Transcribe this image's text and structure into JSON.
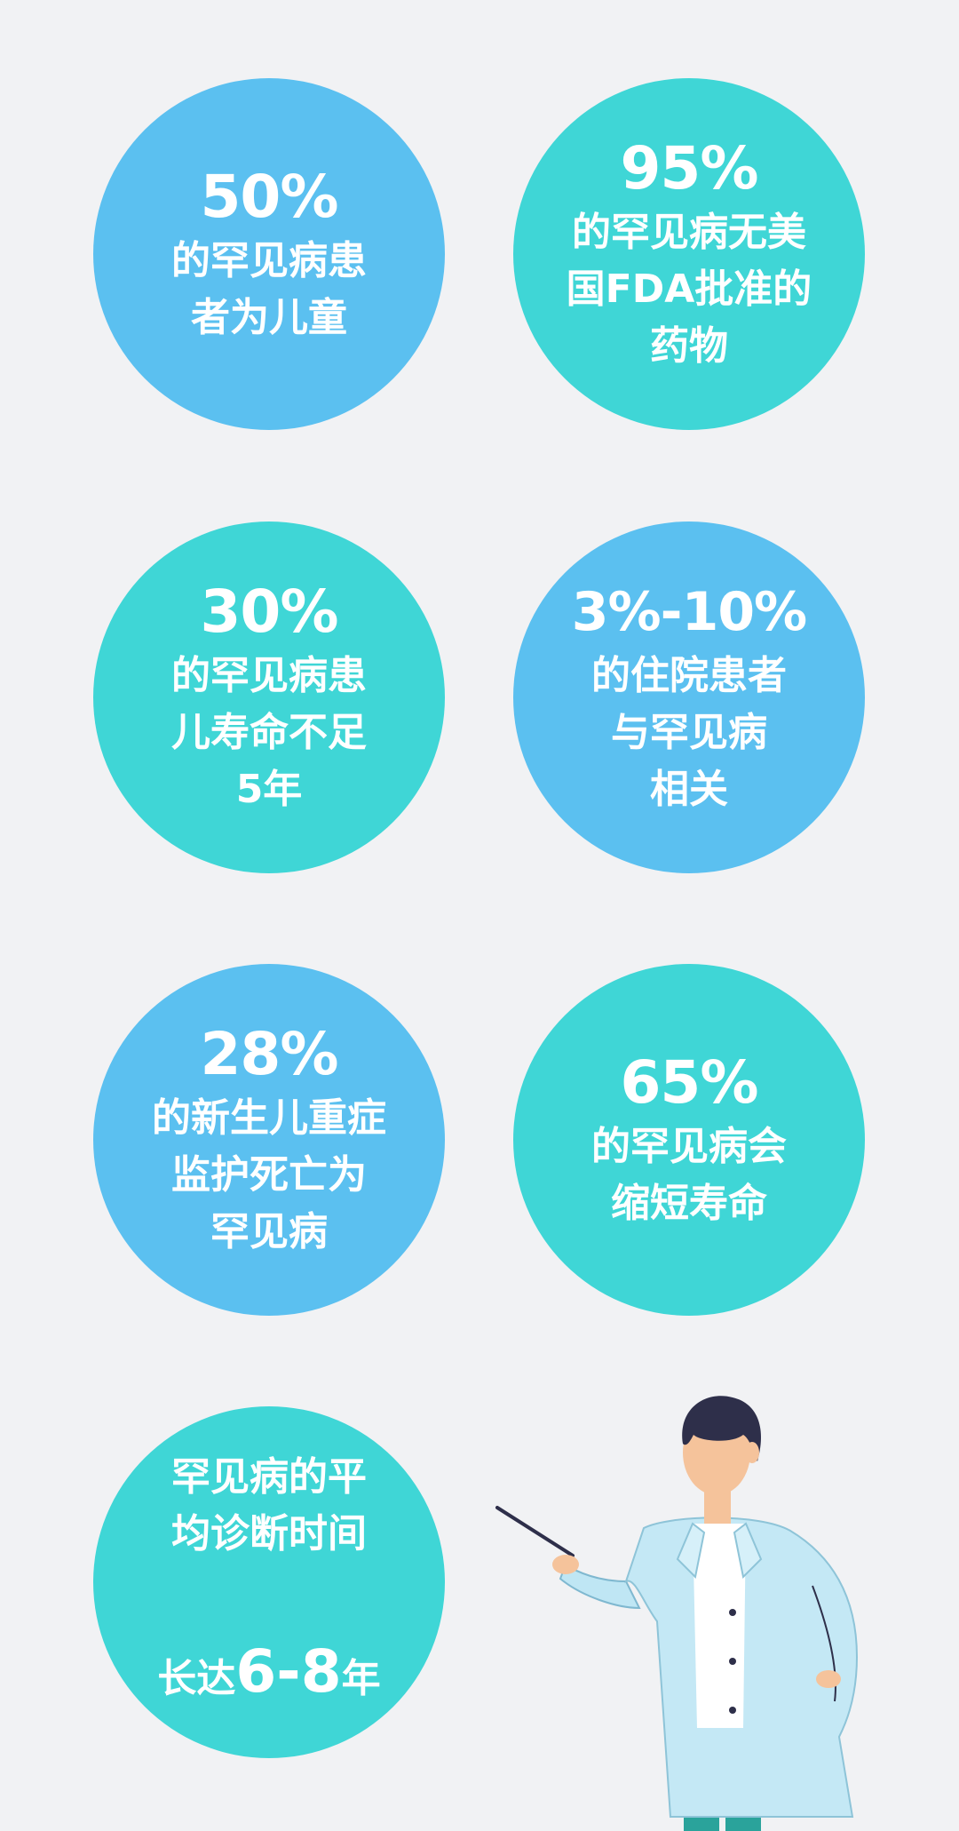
{
  "colors": {
    "background": "#f1f2f4",
    "blue": "#5bc0f0",
    "teal": "#3fd6d6",
    "text": "#ffffff"
  },
  "cards": [
    {
      "stat": "50%",
      "desc": "的罕见病患\n者为儿童"
    },
    {
      "stat": "95%",
      "desc": "的罕见病无美\n国FDA批准的\n药物"
    },
    {
      "stat": "30%",
      "desc": "的罕见病患\n儿寿命不足\n5年"
    },
    {
      "stat": "3%-10%",
      "desc": "的住院患者\n与罕见病\n相关"
    },
    {
      "stat": "28%",
      "desc": "的新生儿重症\n监护死亡为\n罕见病"
    },
    {
      "stat": "65%",
      "desc": "的罕见病会\n缩短寿命"
    }
  ],
  "last_card": {
    "line1": "罕见病的平",
    "line2": "均诊断时间",
    "line3_prefix": "长达",
    "line3_number": "6-8",
    "line3_suffix": "年"
  },
  "illustration": "doctor-with-pointer"
}
